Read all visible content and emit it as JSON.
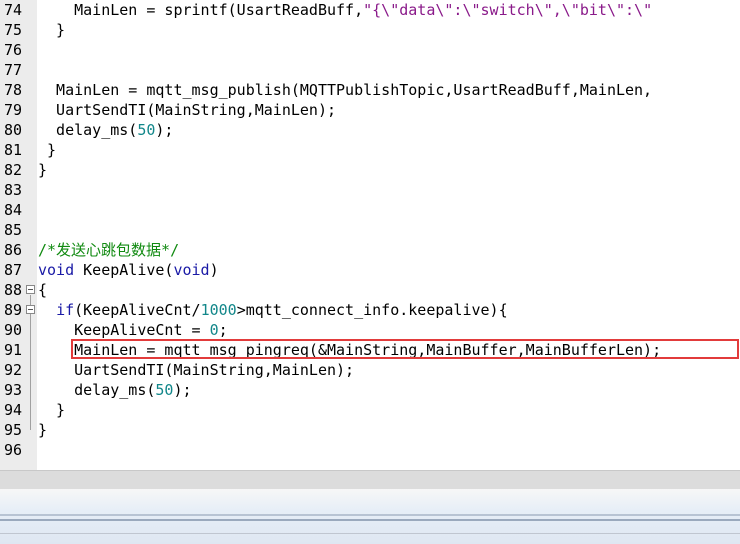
{
  "editor": {
    "lines": [
      {
        "num": "74",
        "code": [
          {
            "t": "ind",
            "v": "    MainLen = sprintf(UsartReadBuff,"
          },
          {
            "t": "s",
            "v": "\"{\\\"data\\\":\\\"switch\\\",\\\"bit\\\":\\\""
          }
        ]
      },
      {
        "num": "75",
        "code": [
          {
            "t": "ind",
            "v": "  }"
          }
        ]
      },
      {
        "num": "76",
        "code": []
      },
      {
        "num": "77",
        "code": []
      },
      {
        "num": "78",
        "code": [
          {
            "t": "ind",
            "v": "  MainLen = mqtt_msg_publish(MQTTPublishTopic,UsartReadBuff,MainLen,"
          }
        ]
      },
      {
        "num": "79",
        "code": [
          {
            "t": "ind",
            "v": "  UartSendTI(MainString,MainLen);"
          }
        ]
      },
      {
        "num": "80",
        "code": [
          {
            "t": "ind",
            "v": "  delay_ms("
          },
          {
            "t": "n",
            "v": "50"
          },
          {
            "t": "ind",
            "v": ");"
          }
        ]
      },
      {
        "num": "81",
        "code": [
          {
            "t": "ind",
            "v": " }"
          }
        ]
      },
      {
        "num": "82",
        "code": [
          {
            "t": "ind",
            "v": "}"
          }
        ]
      },
      {
        "num": "83",
        "code": []
      },
      {
        "num": "84",
        "code": []
      },
      {
        "num": "85",
        "code": []
      },
      {
        "num": "86",
        "code": [
          {
            "t": "c",
            "v": "/*发送心跳包数据*/"
          }
        ]
      },
      {
        "num": "87",
        "code": [
          {
            "t": "k",
            "v": "void"
          },
          {
            "t": "ind",
            "v": " KeepAlive("
          },
          {
            "t": "k",
            "v": "void"
          },
          {
            "t": "ind",
            "v": ")"
          }
        ]
      },
      {
        "num": "88",
        "code": [
          {
            "t": "ind",
            "v": "{"
          }
        ],
        "fold": true
      },
      {
        "num": "89",
        "code": [
          {
            "t": "ind",
            "v": "  "
          },
          {
            "t": "k",
            "v": "if"
          },
          {
            "t": "ind",
            "v": "(KeepAliveCnt/"
          },
          {
            "t": "n",
            "v": "1000"
          },
          {
            "t": "ind",
            "v": ">mqtt_connect_info.keepalive){"
          }
        ],
        "fold": true
      },
      {
        "num": "90",
        "code": [
          {
            "t": "ind",
            "v": "    KeepAliveCnt = "
          },
          {
            "t": "n",
            "v": "0"
          },
          {
            "t": "ind",
            "v": ";"
          }
        ]
      },
      {
        "num": "91",
        "code": [
          {
            "t": "ind",
            "v": "    MainLen = mqtt_msg_pingreq(&MainString,MainBuffer,MainBufferLen);"
          }
        ]
      },
      {
        "num": "92",
        "code": [
          {
            "t": "ind",
            "v": "    UartSendTI(MainString,MainLen);"
          }
        ]
      },
      {
        "num": "93",
        "code": [
          {
            "t": "ind",
            "v": "    delay_ms("
          },
          {
            "t": "n",
            "v": "50"
          },
          {
            "t": "ind",
            "v": ");"
          }
        ]
      },
      {
        "num": "94",
        "code": [
          {
            "t": "ind",
            "v": "  }"
          }
        ]
      },
      {
        "num": "95",
        "code": [
          {
            "t": "ind",
            "v": "}"
          }
        ]
      },
      {
        "num": "96",
        "code": []
      }
    ]
  },
  "theme": {
    "keyword": "#1a1aa6",
    "string": "#8a1a8a",
    "number": "#12878a",
    "comment": "#108a10",
    "highlight_border": "#e23b3b"
  },
  "icons": {
    "fold_marker": "collapse-box-icon"
  }
}
